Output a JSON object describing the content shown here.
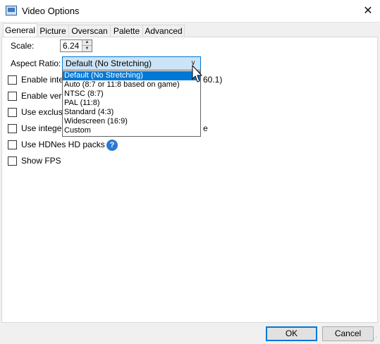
{
  "window": {
    "title": "Video Options",
    "close_glyph": "✕"
  },
  "tabs": [
    {
      "label": "General",
      "active": true
    },
    {
      "label": "Picture"
    },
    {
      "label": "Overscan"
    },
    {
      "label": "Palette"
    },
    {
      "label": "Advanced"
    }
  ],
  "scale": {
    "label": "Scale:",
    "value": "6.24"
  },
  "aspect_ratio": {
    "label": "Aspect Ratio:",
    "selected": "Default (No Stretching)",
    "options": [
      "Default (No Stretching)",
      "Auto (8:7 or 11:8 based on game)",
      "NTSC (8:7)",
      "PAL (11:8)",
      "Standard (4:3)",
      "Widescreen (16:9)",
      "Custom"
    ]
  },
  "checkboxes": [
    {
      "label": "Enable integ",
      "trailing": "60.1)",
      "checked": false
    },
    {
      "label": "Enable verti",
      "checked": false
    },
    {
      "label": "Use exclusiv",
      "checked": false
    },
    {
      "label": "Use integer",
      "trailing": "e",
      "checked": false
    },
    {
      "label": "Use HDNes HD packs",
      "checked": false
    },
    {
      "label": "Show FPS",
      "checked": false
    }
  ],
  "help_icon": "question-mark-icon",
  "buttons": {
    "ok": "OK",
    "cancel": "Cancel"
  },
  "colors": {
    "accent": "#0078d7",
    "selection": "#cce4f7"
  }
}
